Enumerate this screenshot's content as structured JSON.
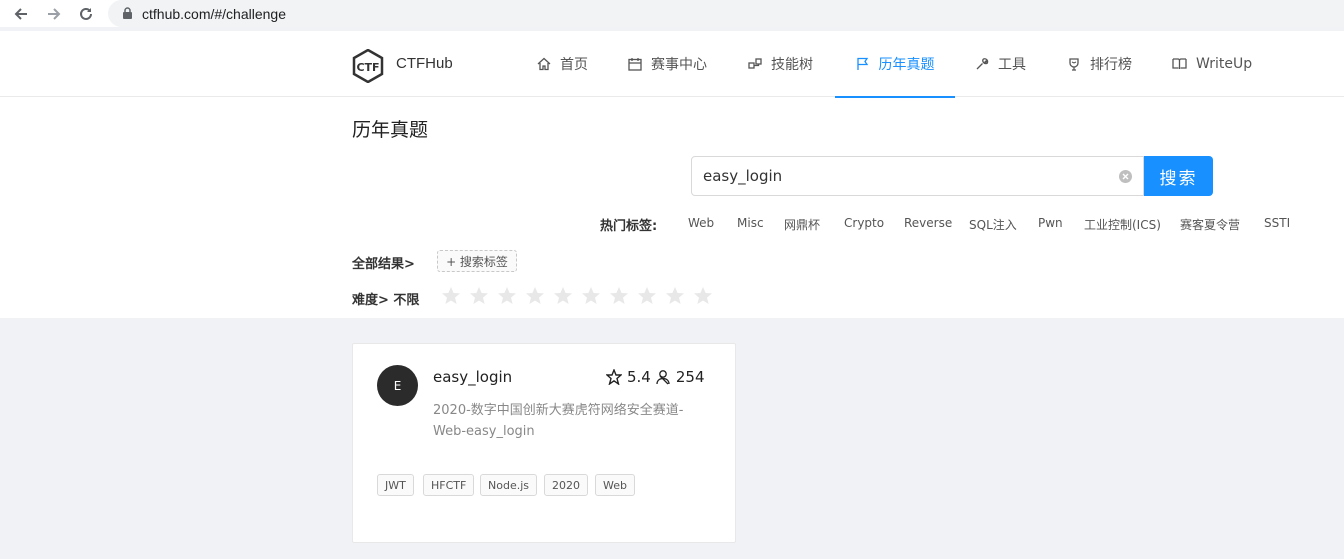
{
  "browser": {
    "url": "ctfhub.com/#/challenge"
  },
  "header": {
    "logo_text": "CTFHub",
    "menu": [
      {
        "label": "首页",
        "icon": "home-icon"
      },
      {
        "label": "赛事中心",
        "icon": "calendar-icon"
      },
      {
        "label": "技能树",
        "icon": "tree-icon"
      },
      {
        "label": "历年真题",
        "icon": "flag-icon",
        "active": true
      },
      {
        "label": "工具",
        "icon": "wrench-icon"
      },
      {
        "label": "排行榜",
        "icon": "trophy-icon"
      },
      {
        "label": "WriteUp",
        "icon": "book-icon"
      }
    ]
  },
  "page": {
    "title": "历年真题"
  },
  "search": {
    "value": "easy_login",
    "button_label": "搜索"
  },
  "hot_tags": {
    "label": "热门标签:",
    "tags": [
      "Web",
      "Misc",
      "网鼎杯",
      "Crypto",
      "Reverse",
      "SQL注入",
      "Pwn",
      "工业控制(ICS)",
      "赛客夏令营",
      "SSTI"
    ]
  },
  "filters": {
    "all_results": "全部结果>",
    "tag_search": "+ 搜索标签",
    "difficulty": "难度> 不限",
    "stars": 10
  },
  "challenge": {
    "avatar": "E",
    "title": "easy_login",
    "rating": "5.4",
    "solves": "254",
    "description": "2020-数字中国创新大赛虎符网络安全赛道-Web-easy_login",
    "tags": [
      "JWT",
      "HFCTF",
      "Node.js",
      "2020",
      "Web"
    ]
  },
  "colors": {
    "accent": "#1890ff",
    "avatar_bg": "#2b2b2b"
  }
}
